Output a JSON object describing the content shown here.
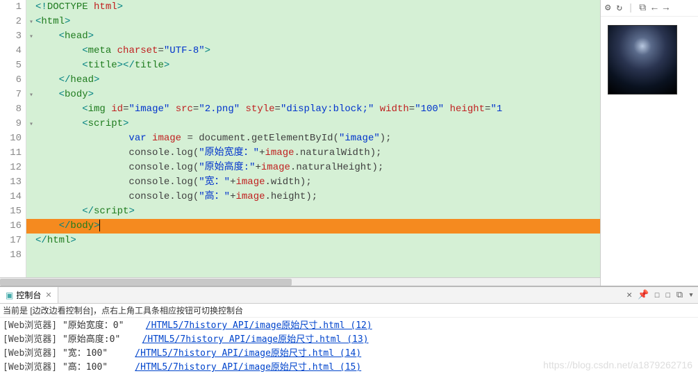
{
  "gutter": [
    "1",
    "2",
    "3",
    "4",
    "5",
    "6",
    "7",
    "8",
    "9",
    "10",
    "11",
    "12",
    "13",
    "14",
    "15",
    "16",
    "17",
    "18"
  ],
  "fold": [
    "",
    "▾",
    "▾",
    "",
    "",
    "",
    "▾",
    "",
    "▾",
    "",
    "",
    "",
    "",
    "",
    "",
    "",
    "",
    ""
  ],
  "code": {
    "l1": {
      "d1": "<!",
      "tag": "DOCTYPE",
      "sp": " ",
      "attr": "html",
      "d2": ">"
    },
    "l2": {
      "d1": "<",
      "tag": "html",
      "d2": ">"
    },
    "l3": {
      "d1": "<",
      "tag": "head",
      "d2": ">"
    },
    "l4": {
      "d1": "<",
      "tag": "meta",
      "sp": " ",
      "attr": "charset",
      "eq": "=",
      "val": "\"UTF-8\"",
      "d2": ">"
    },
    "l5": {
      "d1": "<",
      "tag": "title",
      "d2": ">",
      "d3": "</",
      "tag2": "title",
      "d4": ">"
    },
    "l6": {
      "d1": "</",
      "tag": "head",
      "d2": ">"
    },
    "l7": {
      "d1": "<",
      "tag": "body",
      "d2": ">"
    },
    "l8": {
      "d1": "<",
      "tag": "img",
      "sp": " ",
      "a1": "id",
      "eq1": "=",
      "v1": "\"image\"",
      "sp2": " ",
      "a2": "src",
      "eq2": "=",
      "v2": "\"2.png\"",
      "sp3": " ",
      "a3": "style",
      "eq3": "=",
      "v3": "\"display:block;\"",
      "sp4": " ",
      "a4": "width",
      "eq4": "=",
      "v4": "\"100\"",
      "sp5": " ",
      "a5": "height",
      "eq5": "=",
      "v5": "\"1"
    },
    "l9": {
      "d1": "<",
      "tag": "script",
      "d2": ">"
    },
    "l10": {
      "kw": "var",
      "sp": " ",
      "name": "image",
      "sp2": " ",
      "eq": "=",
      "sp3": " ",
      "obj": "document",
      "dot": ".",
      "fn": "getElementById",
      "p1": "(",
      "str": "\"image\"",
      "p2": ")",
      "semi": ";"
    },
    "l11": {
      "obj": "console",
      "dot": ".",
      "fn": "log",
      "p1": "(",
      "str": "\"原始宽度：\"",
      "plus": "+",
      "name": "image",
      "dot2": ".",
      "prop": "naturalWidth",
      "p2": ")",
      "semi": ";"
    },
    "l12": {
      "obj": "console",
      "dot": ".",
      "fn": "log",
      "p1": "(",
      "str": "\"原始高度:\"",
      "plus": "+",
      "name": "image",
      "dot2": ".",
      "prop": "naturalHeight",
      "p2": ")",
      "semi": ";"
    },
    "l13": {
      "obj": "console",
      "dot": ".",
      "fn": "log",
      "p1": "(",
      "str": "\"宽：\"",
      "plus": "+",
      "name": "image",
      "dot2": ".",
      "prop": "width",
      "p2": ")",
      "semi": ";"
    },
    "l14": {
      "obj": "console",
      "dot": ".",
      "fn": "log",
      "p1": "(",
      "str": "\"高：\"",
      "plus": "+",
      "name": "image",
      "dot2": ".",
      "prop": "height",
      "p2": ")",
      "semi": ";"
    },
    "l15": {
      "d1": "</",
      "tag": "script",
      "d2": ">"
    },
    "l16": {
      "d1": "</",
      "tag": "body",
      "d2": ">"
    },
    "l17": {
      "d1": "</",
      "tag": "html",
      "d2": ">"
    }
  },
  "console": {
    "tab_label": "控制台",
    "hint": "当前是 [边改边看控制台]，点右上角工具条相应按钮可切换控制台",
    "rows": [
      {
        "src": "[Web浏览器]",
        "msg": "\"原始宽度：0\"",
        "link": "/HTML5/7history API/image原始尺寸.html (12)"
      },
      {
        "src": "[Web浏览器]",
        "msg": "\"原始高度:0\"",
        "link": "/HTML5/7history API/image原始尺寸.html (13)"
      },
      {
        "src": "[Web浏览器]",
        "msg": "\"宽：100\"",
        "link": "/HTML5/7history API/image原始尺寸.html (14)"
      },
      {
        "src": "[Web浏览器]",
        "msg": "\"高：100\"",
        "link": "/HTML5/7history API/image原始尺寸.html (15)"
      }
    ]
  },
  "side_icons": {
    "gear": "⚙",
    "refresh": "↻",
    "box": "⧉",
    "back": "←",
    "fwd": "→"
  },
  "right_icons": {
    "close": "✕",
    "pin": "📌",
    "a": "☐",
    "b": "☐",
    "c": "⧉",
    "d": "▾"
  },
  "watermark": "https://blog.csdn.net/a1879262716"
}
